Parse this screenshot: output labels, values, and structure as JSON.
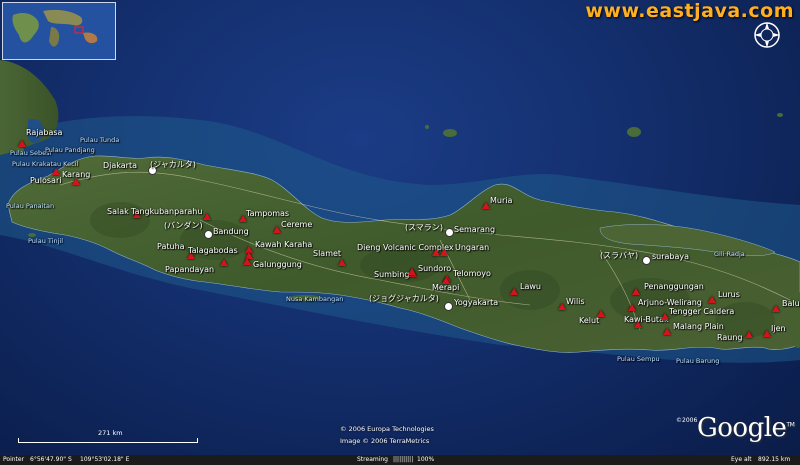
{
  "site": {
    "url": "www.eastjava.com"
  },
  "places": [
    {
      "id": "rajabasa",
      "label": "Rajabasa",
      "type": "volcano",
      "kind": "land"
    },
    {
      "id": "pulau-tunda",
      "label": "Pulau Tunda",
      "type": "none",
      "kind": "sea"
    },
    {
      "id": "pulau-sebesi",
      "label": "Pulau Sebesi",
      "type": "none",
      "kind": "sea"
    },
    {
      "id": "pulau-panjang",
      "label": "Pulau Pandjang",
      "type": "none",
      "kind": "sea"
    },
    {
      "id": "pulau-krakatau-kecil",
      "label": "Pulau Krakatau Kecil",
      "type": "none",
      "kind": "sea"
    },
    {
      "id": "pulosari",
      "label": "Pulosari",
      "type": "volcano",
      "kind": "land"
    },
    {
      "id": "karang",
      "label": "Karang",
      "type": "volcano",
      "kind": "land"
    },
    {
      "id": "pulau-pinaitan",
      "label": "Pulau Panaitan",
      "type": "none",
      "kind": "sea"
    },
    {
      "id": "pulau-tinjil",
      "label": "Pulau Tinjil",
      "type": "none",
      "kind": "sea"
    },
    {
      "id": "djakarta",
      "label": "Djakarta",
      "type": "city",
      "kind": "land"
    },
    {
      "id": "jakarta-jp",
      "label": "(ジャカルタ)",
      "type": "none",
      "kind": "land"
    },
    {
      "id": "salak",
      "label": "Salak",
      "type": "volcano",
      "kind": "land"
    },
    {
      "id": "tangkuban",
      "label": "Tangkubanparahu",
      "type": "volcano",
      "kind": "land"
    },
    {
      "id": "bandung-jp",
      "label": "(バンダン)",
      "type": "none",
      "kind": "land"
    },
    {
      "id": "bandung",
      "label": "Bandung",
      "type": "city",
      "kind": "land"
    },
    {
      "id": "tampomas",
      "label": "Tampomas",
      "type": "volcano",
      "kind": "land"
    },
    {
      "id": "cereme",
      "label": "Cereme",
      "type": "volcano",
      "kind": "land"
    },
    {
      "id": "patuha",
      "label": "Patuha",
      "type": "volcano",
      "kind": "land"
    },
    {
      "id": "kawah-karaha",
      "label": "Kawah Karaha",
      "type": "volcano",
      "kind": "land"
    },
    {
      "id": "talagabodas",
      "label": "Talagabodas",
      "type": "volcano",
      "kind": "land"
    },
    {
      "id": "galunggung",
      "label": "Galunggung",
      "type": "volcano",
      "kind": "land"
    },
    {
      "id": "papandayan",
      "label": "Papandayan",
      "type": "volcano",
      "kind": "land"
    },
    {
      "id": "slamet",
      "label": "Slamet",
      "type": "volcano",
      "kind": "land"
    },
    {
      "id": "nusa-kambangan",
      "label": "Nusa Kambangan",
      "type": "none",
      "kind": "sea"
    },
    {
      "id": "dieng",
      "label": "Dieng Volcanic Complex",
      "type": "volcano",
      "kind": "land"
    },
    {
      "id": "semarang-jp",
      "label": "(スマラン)",
      "type": "none",
      "kind": "land"
    },
    {
      "id": "semarang",
      "label": "Semarang",
      "type": "city",
      "kind": "land"
    },
    {
      "id": "ungaran",
      "label": "Ungaran",
      "type": "volcano",
      "kind": "land"
    },
    {
      "id": "muria",
      "label": "Muria",
      "type": "volcano",
      "kind": "land"
    },
    {
      "id": "sumbing",
      "label": "Sumbing",
      "type": "volcano",
      "kind": "land"
    },
    {
      "id": "sundoro",
      "label": "Sundoro",
      "type": "volcano",
      "kind": "land"
    },
    {
      "id": "telomoyo",
      "label": "Telomoyo",
      "type": "volcano",
      "kind": "land"
    },
    {
      "id": "merapi",
      "label": "Merapi",
      "type": "volcano",
      "kind": "land"
    },
    {
      "id": "yogya-jp",
      "label": "(ジョグジャカルタ)",
      "type": "none",
      "kind": "land"
    },
    {
      "id": "yogyakarta",
      "label": "Yogyakarta",
      "type": "city",
      "kind": "land"
    },
    {
      "id": "lawu",
      "label": "Lawu",
      "type": "volcano",
      "kind": "land"
    },
    {
      "id": "wilis",
      "label": "Wilis",
      "type": "volcano",
      "kind": "land"
    },
    {
      "id": "kelut",
      "label": "Kelut",
      "type": "volcano",
      "kind": "land"
    },
    {
      "id": "surabaya-jp",
      "label": "(スラバヤ)",
      "type": "none",
      "kind": "land"
    },
    {
      "id": "surabaya",
      "label": "surabaya",
      "type": "city",
      "kind": "land"
    },
    {
      "id": "gili-radja",
      "label": "Gili Radja",
      "type": "none",
      "kind": "sea"
    },
    {
      "id": "penanggungan",
      "label": "Penanggungan",
      "type": "volcano",
      "kind": "land"
    },
    {
      "id": "arjuno",
      "label": "Arjuno-Welirang",
      "type": "volcano",
      "kind": "land"
    },
    {
      "id": "kawi-butak",
      "label": "Kawi-Butak",
      "type": "volcano",
      "kind": "land"
    },
    {
      "id": "tengger",
      "label": "Tengger Caldera",
      "type": "volcano",
      "kind": "land"
    },
    {
      "id": "malang-plain",
      "label": "Malang Plain",
      "type": "volcano",
      "kind": "land"
    },
    {
      "id": "lurus",
      "label": "Lurus",
      "type": "volcano",
      "kind": "land"
    },
    {
      "id": "baluran",
      "label": "Balur",
      "type": "volcano",
      "kind": "land"
    },
    {
      "id": "raung",
      "label": "Raung",
      "type": "volcano",
      "kind": "land"
    },
    {
      "id": "ijen",
      "label": "Ijen",
      "type": "volcano",
      "kind": "land"
    },
    {
      "id": "pulau-sempu",
      "label": "Pulau Sempu",
      "type": "none",
      "kind": "sea"
    },
    {
      "id": "pulau-barung",
      "label": "Pulau Barung",
      "type": "none",
      "kind": "sea"
    }
  ],
  "credits": {
    "line1": "© 2006 Europa Technologies",
    "line2": "Image © 2006 TerraMetrics"
  },
  "logo": {
    "google": "Google",
    "year": "©2006",
    "tm": "TM"
  },
  "scale": {
    "label": "271 km"
  },
  "status": {
    "pointer_label": "Pointer",
    "lat": "6°56'47.90\" S",
    "lon": "109°53'02.18\" E",
    "streaming_label": "Streaming",
    "streaming_bar": "||||||||||",
    "streaming_pct": "100%",
    "eye_label": "Eye alt",
    "eye_value": "892.15 km"
  },
  "colors": {
    "volcano": "#d4141c",
    "site_url": "#ffb020",
    "land": "#3e5a2c",
    "sea": "#14306f"
  }
}
